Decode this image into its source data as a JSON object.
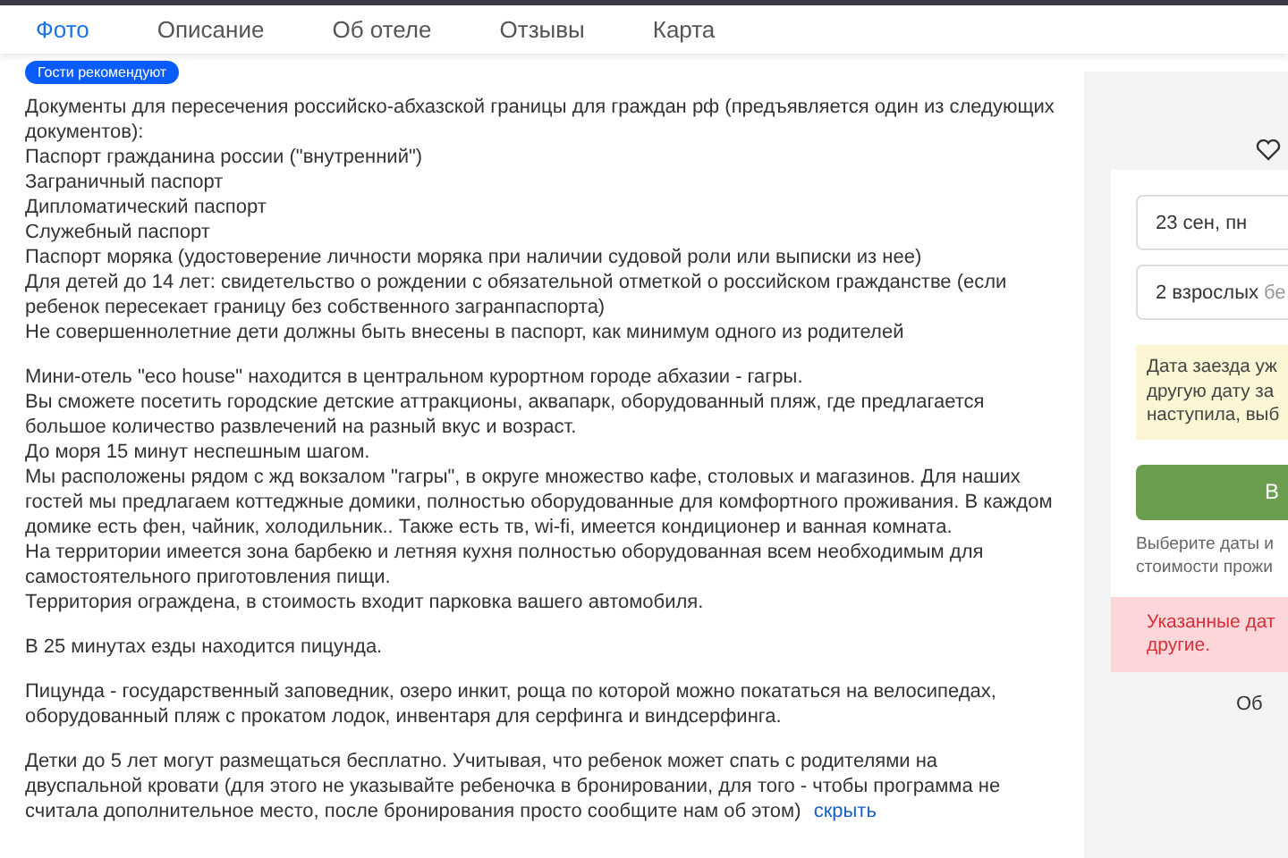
{
  "tabs": [
    {
      "label": "Фото",
      "selected": true
    },
    {
      "label": "Описание",
      "selected": false
    },
    {
      "label": "Об отеле",
      "selected": false
    },
    {
      "label": "Отзывы",
      "selected": false
    },
    {
      "label": "Карта",
      "selected": false
    }
  ],
  "badge": "Гости рекомендуют",
  "description": {
    "paragraphs": [
      [
        "Документы для пересечения российско-абхазской границы для граждан рф (предъявляется один из следующих документов):",
        "Паспорт гражданина россии (\"внутренний\")",
        "Заграничный паспорт",
        "Дипломатический паспорт",
        "Служебный паспорт",
        "Паспорт моряка (удостоверение личности моряка при наличии судовой роли или выписки из нее)",
        "Для детей до 14 лет: свидетельство о рождении с обязательной отметкой о российском гражданстве (если ребенок пересекает границу без собственного загранпаспорта)",
        "Не совершеннолетние дети должны быть внесены в паспорт, как минимум одного из родителей"
      ],
      [
        "Мини-отель \"eco house\" находится в центральном курортном городе абхазии - гагры.",
        "Вы сможете посетить городские детские аттракционы, аквапарк, оборудованный пляж, где предлагается большое количество развлечений на разный вкус и возраст.",
        "До моря 15 минут неспешным шагом.",
        "Мы расположены рядом с жд вокзалом \"гагры\", в округе множество кафе, столовых и магазинов. Для наших гостей мы предлагаем коттеджные домики, полностью оборудованные для комфортного проживания. В каждом домике есть фен, чайник, холодильник.. Также есть тв, wi-fi, имеется кондиционер и ванная комната.",
        "На территории имеется зона барбекю и летняя кухня полностью оборудованная всем необходимым для самостоятельного приготовления пищи.",
        "Территория ограждена, в стоимость входит парковка вашего автомобиля."
      ],
      [
        "В 25 минутах езды находится пицунда."
      ],
      [
        "Пицунда - государственный заповедник, озеро инкит, роща по которой можно покататься на велосипедах, оборудованный пляж с прокатом лодок, инвентаря для серфинга и виндсерфинга."
      ],
      [
        "Детки до 5 лет могут размещаться бесплатно. Учитывая, что ребенок может спать с родителями на двуспальной кровати (для этого не указывайте ребеночка в бронировании, для того - чтобы программа не считала дополнительное место, после бронирования просто сообщите нам об этом)"
      ]
    ],
    "hide_link": "скрыть"
  },
  "booking": {
    "date": "23 сен, пн",
    "guests": "2 взрослых",
    "guests_extra": "бе",
    "warning": [
      "Дата заезда уж",
      "другую дату за",
      "наступила, выб"
    ],
    "button": "В",
    "hint": [
      "Выберите даты и",
      "стоимости прожи"
    ],
    "error": [
      "Указанные дат",
      "другие."
    ],
    "footer": "Об"
  }
}
